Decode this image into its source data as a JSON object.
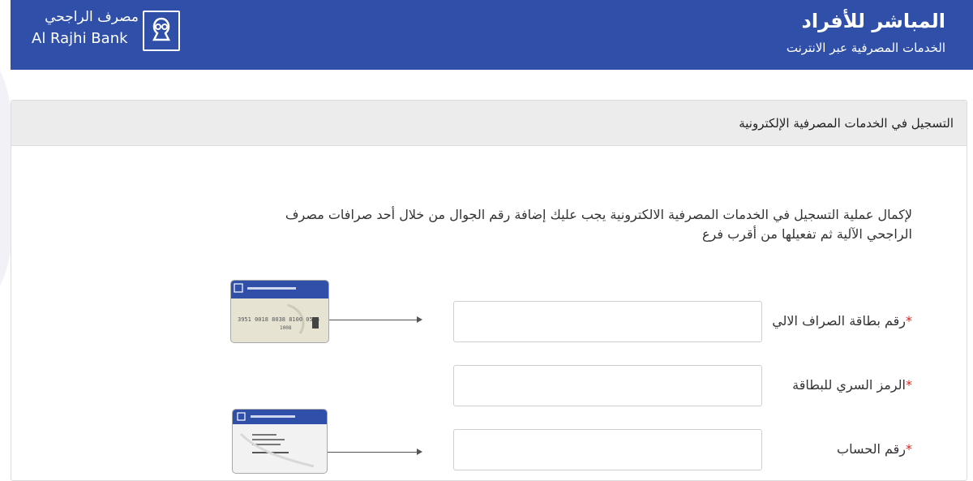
{
  "header": {
    "title": "المباشر للأفراد",
    "subtitle": "الخدمات المصرفية عبر الانترنت",
    "logo_arabic": "مصرف الراجحي",
    "logo_english": "Al Rajhi Bank",
    "bg_color": "#2f4fa8"
  },
  "panel": {
    "title": "التسجيل في الخدمات المصرفية الإلكترونية"
  },
  "intro_text": "لإكمال عملية التسجيل في الخدمات المصرفية الالكترونية يجب عليك إضافة رقم الجوال من خلال أحد صرافات مصرف الراجحي الآلية ثم تفعيلها من أقرب فرع",
  "form": {
    "required_mark": "*",
    "fields": [
      {
        "label": "رقم بطاقة الصراف الالي",
        "value": "",
        "icon": "atm-card-image"
      },
      {
        "label": "الرمز السري للبطاقة",
        "value": ""
      },
      {
        "label": "رقم الحساب",
        "value": "",
        "icon": "account-card-image"
      }
    ]
  },
  "card_sample": {
    "number_groups": [
      "3951",
      "0018",
      "8038",
      "8100",
      "0555"
    ],
    "short_text": "1008"
  },
  "colors": {
    "accent": "#2f4fa8",
    "required": "#d9261c"
  }
}
